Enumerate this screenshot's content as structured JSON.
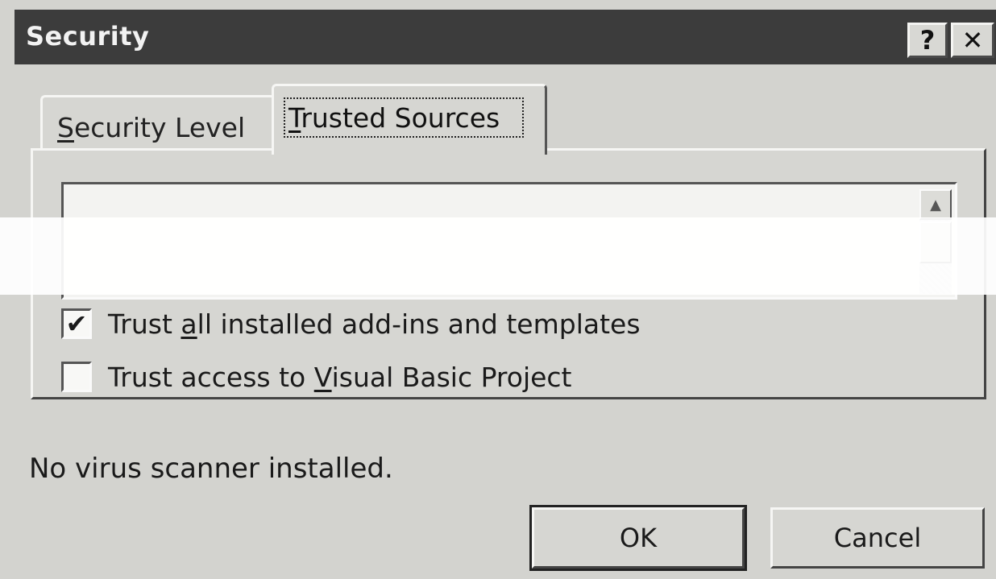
{
  "window": {
    "title": "Security",
    "help_label": "?",
    "close_label": "✕"
  },
  "tabs": [
    {
      "label_prefix": "",
      "accel": "S",
      "label_rest": "ecurity Level",
      "active": false
    },
    {
      "label_prefix": "",
      "accel": "T",
      "label_rest": "rusted Sources",
      "active": true
    }
  ],
  "trusted_sources": {
    "list_items": [],
    "scroll_up_icon": "▲"
  },
  "options": [
    {
      "prefix": "Trust ",
      "accel": "a",
      "rest": "ll installed add-ins and templates",
      "checked": true,
      "check_glyph": "✔"
    },
    {
      "prefix": "Trust access to ",
      "accel": "V",
      "rest": "isual Basic Project",
      "checked": false,
      "check_glyph": ""
    }
  ],
  "status": "No virus scanner installed.",
  "buttons": {
    "ok": "OK",
    "cancel": "Cancel"
  }
}
